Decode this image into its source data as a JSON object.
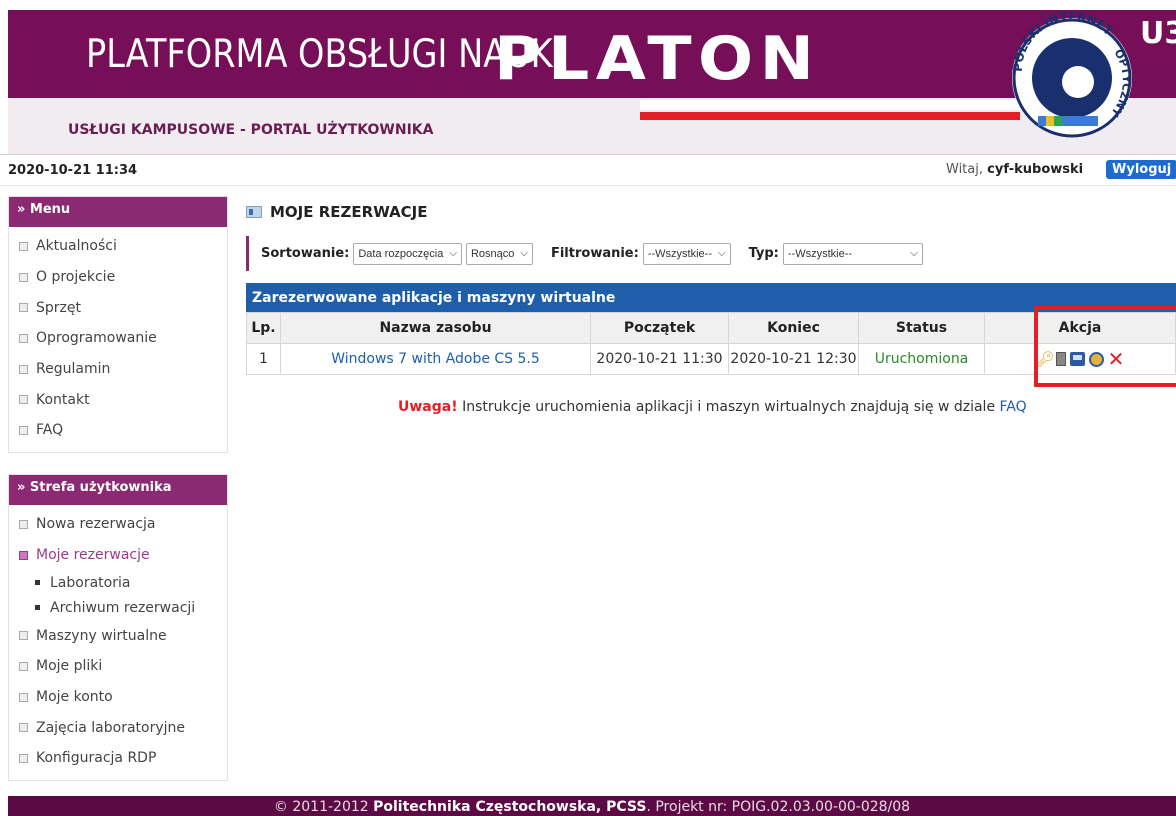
{
  "header": {
    "title": "PLATFORMA OBSŁUGI NAUKI",
    "brand": "PLATON",
    "brand_suffix": "U3",
    "subtitle": "USŁUGI KAMPUSOWE - PORTAL UŻYTKOWNIKA",
    "logo_text_top": "POLSKI INTERNET",
    "logo_text_right": "OPTYCZNY",
    "logo_text_bottom": "PIONIER"
  },
  "infobar": {
    "datetime": "2020-10-21 11:34",
    "welcome_prefix": "Witaj,",
    "username": "cyf-kubowski",
    "logout_label": "Wyloguj"
  },
  "sidebar": {
    "menu_title": "» Menu",
    "menu_items": [
      "Aktualności",
      "O projekcie",
      "Sprzęt",
      "Oprogramowanie",
      "Regulamin",
      "Kontakt",
      "FAQ"
    ],
    "user_title": "» Strefa użytkownika",
    "user_items": [
      {
        "label": "Nowa rezerwacja"
      },
      {
        "label": "Moje rezerwacje"
      },
      {
        "label": "Laboratoria"
      },
      {
        "label": "Archiwum rezerwacji"
      },
      {
        "label": "Maszyny wirtualne"
      },
      {
        "label": "Moje pliki"
      },
      {
        "label": "Moje konto"
      },
      {
        "label": "Zajęcia laboratoryjne"
      },
      {
        "label": "Konfiguracja RDP"
      }
    ]
  },
  "main": {
    "title": "MOJE REZERWACJE",
    "filters": {
      "sort_label": "Sortowanie:",
      "sort_by": "Data rozpoczęcia",
      "sort_order": "Rosnąco",
      "filter_label": "Filtrowanie:",
      "filter_value": "--Wszystkie--",
      "type_label": "Typ:",
      "type_value": "--Wszystkie--"
    },
    "table": {
      "caption": "Zarezerwowane aplikacje i maszyny wirtualne",
      "columns": [
        "Lp.",
        "Nazwa zasobu",
        "Początek",
        "Koniec",
        "Status",
        "Akcja"
      ],
      "rows": [
        {
          "lp": "1",
          "name": "Windows 7 with Adobe CS 5.5",
          "start": "2020-10-21 11:30",
          "end": "2020-10-21 12:30",
          "status": "Uruchomiona",
          "actions": [
            "key-icon",
            "document-icon",
            "computer-icon",
            "clock-icon",
            "delete-icon"
          ]
        }
      ]
    },
    "note": {
      "warning": "Uwaga!",
      "text": "Instrukcje uruchomienia aplikacji i maszyn wirtualnych znajdują się w dziale",
      "link": "FAQ"
    }
  },
  "footer": {
    "copyright": "© 2011-2012",
    "org": "Politechnika Częstochowska, PCSS",
    "project": ". Projekt nr: POIG.02.03.00-00-028/08"
  },
  "colors": {
    "brand_purple": "#760f57",
    "menu_purple": "#8b2a72",
    "table_blue": "#1f5ea8",
    "status_green": "#2a8a2a",
    "highlight_red": "#e41e26"
  }
}
